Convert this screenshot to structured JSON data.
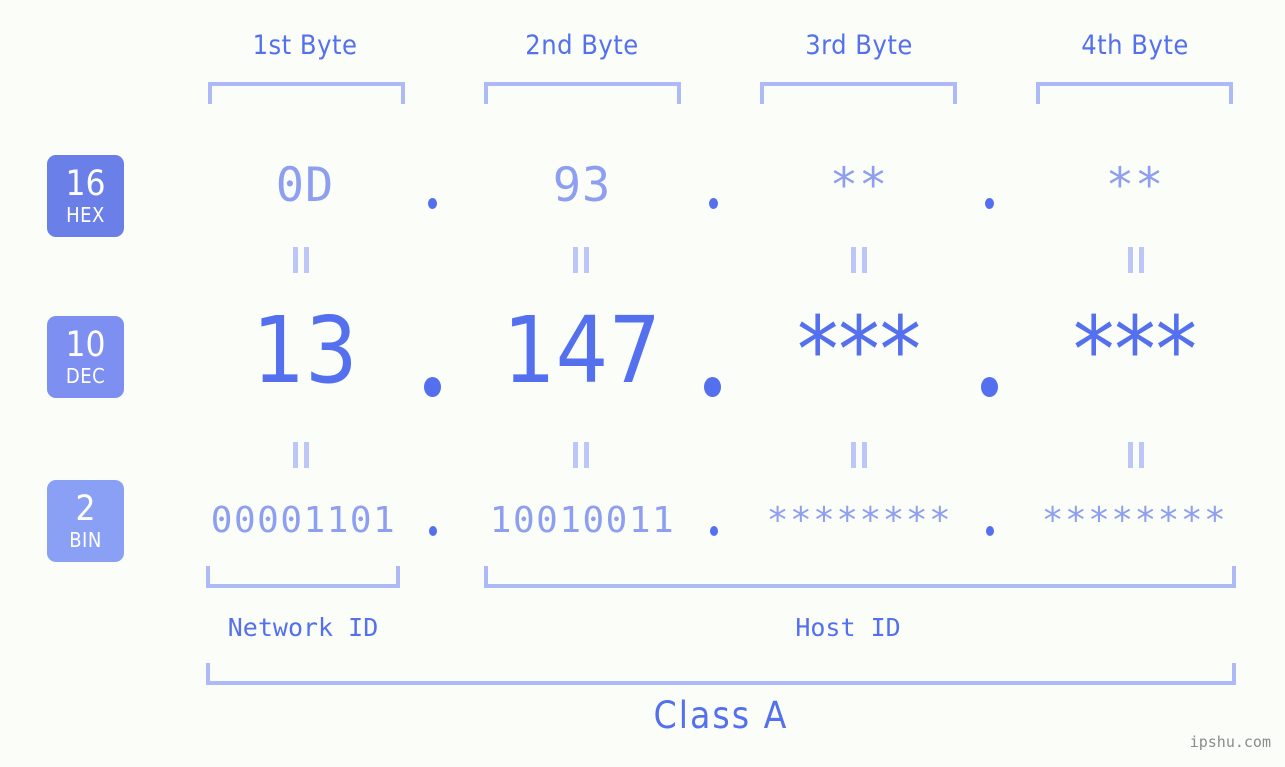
{
  "background_color": "#fbfdf8",
  "accent_color": "#5470ee",
  "muted_accent_color": "#8e9ef0",
  "bracket_color": "#aeb9f7",
  "byte_headers": [
    {
      "label": "1st Byte"
    },
    {
      "label": "2nd Byte"
    },
    {
      "label": "3rd Byte"
    },
    {
      "label": "4th Byte"
    }
  ],
  "rows": {
    "hex": {
      "badge_number": "16",
      "badge_name": "HEX",
      "badge_color": "#6b7fe8",
      "values": [
        "0D",
        "93",
        "**",
        "**"
      ],
      "separator": "."
    },
    "dec": {
      "badge_number": "10",
      "badge_name": "DEC",
      "badge_color": "#7d8ff0",
      "values": [
        "13",
        "147",
        "***",
        "***"
      ],
      "separator": "."
    },
    "bin": {
      "badge_number": "2",
      "badge_name": "BIN",
      "badge_color": "#8aa0f5",
      "values": [
        "00001101",
        "10010011",
        "********",
        "********"
      ],
      "separator": "."
    }
  },
  "equivalence_symbol": "=",
  "id_labels": {
    "network": "Network ID",
    "host": "Host ID"
  },
  "class_label": "Class A",
  "watermark": "ipshu.com"
}
